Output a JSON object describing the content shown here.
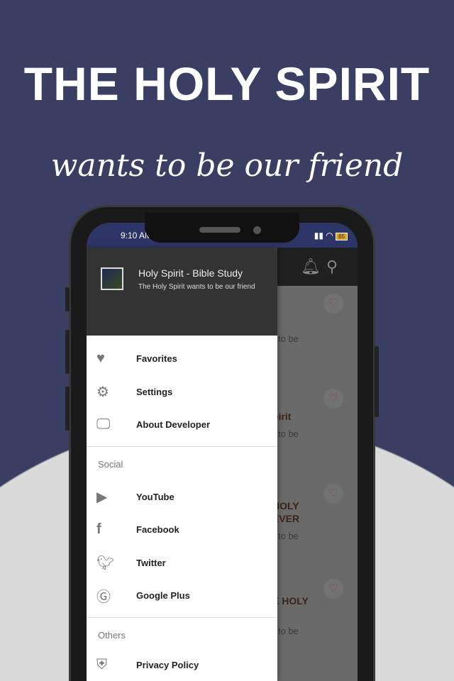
{
  "promo": {
    "title": "THE HOLY SPIRIT",
    "subtitle": "wants to be our friend"
  },
  "status": {
    "time": "9:10 AM",
    "battery": "85"
  },
  "drawer": {
    "app_name": "Holy Spirit - Bible Study",
    "tagline": "The Holy Spirit wants to be our friend",
    "items": [
      {
        "label": "Favorites",
        "icon": "heart-icon"
      },
      {
        "label": "Settings",
        "icon": "gear-icon"
      },
      {
        "label": "About Developer",
        "icon": "monitor-code-icon"
      }
    ],
    "social_header": "Social",
    "social": [
      {
        "label": "YouTube",
        "icon": "youtube-icon"
      },
      {
        "label": "Facebook",
        "icon": "facebook-icon"
      },
      {
        "label": "Twitter",
        "icon": "twitter-icon"
      },
      {
        "label": "Google Plus",
        "icon": "google-plus-icon"
      }
    ],
    "others_header": "Others",
    "others": [
      {
        "label": "Privacy Policy",
        "icon": "shield-lock-icon"
      }
    ]
  },
  "background_list": [
    {
      "title": "",
      "sub": "to be"
    },
    {
      "title": "pirit",
      "sub": "to be"
    },
    {
      "title": "HOLY\nEVER",
      "sub": "to be"
    },
    {
      "title": "E HOLY",
      "sub": "to be"
    }
  ]
}
